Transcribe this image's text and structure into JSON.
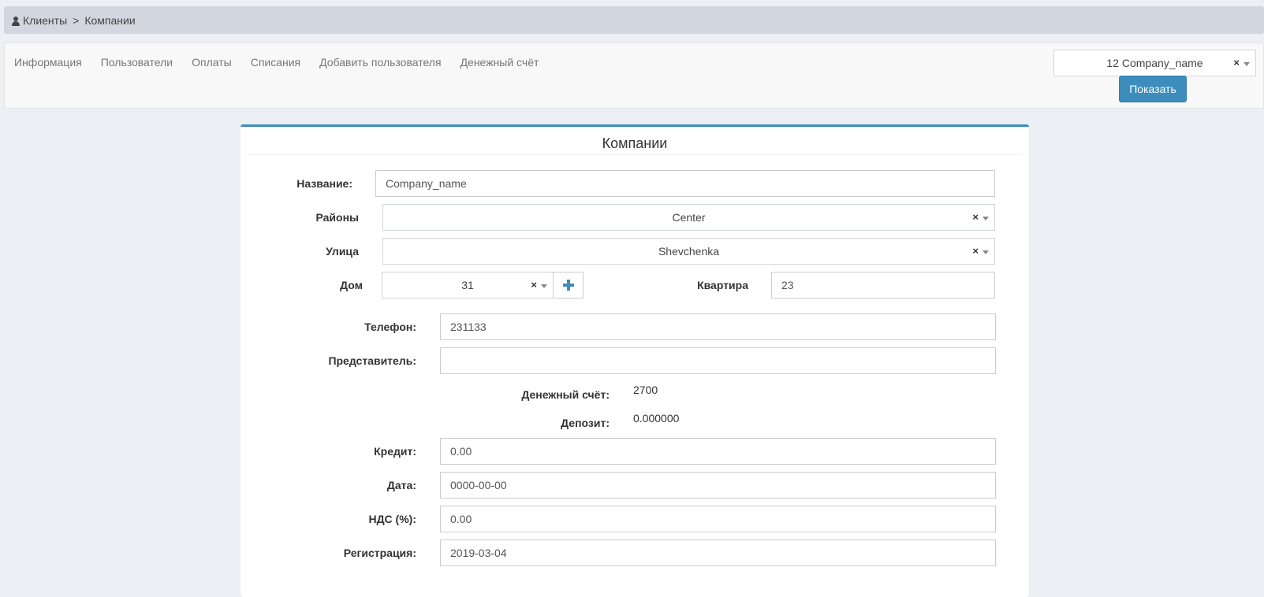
{
  "breadcrumb": {
    "root": "Клиенты",
    "separator": ">",
    "current": "Компании",
    "icon": "user-icon"
  },
  "nav": {
    "links": [
      "Информация",
      "Пользователи",
      "Оплаты",
      "Списания",
      "Добавить пользователя",
      "Денежный счёт"
    ],
    "company_select": "12 Company_name",
    "clear_symbol": "×",
    "show_button": "Показать"
  },
  "form": {
    "title": "Компании",
    "name_label": "Название:",
    "name_value": "Company_name",
    "district_label": "Районы",
    "district_value": "Center",
    "street_label": "Улица",
    "street_value": "Shevchenka",
    "house_label": "Дом",
    "house_value": "31",
    "apartment_label": "Квартира",
    "apartment_value": "23",
    "phone_label": "Телефон:",
    "phone_value": "231133",
    "representative_label": "Представитель:",
    "representative_value": "",
    "account_label": "Денежный счёт:",
    "account_value": "2700",
    "deposit_label": "Депозит:",
    "deposit_value": "0.000000",
    "credit_label": "Кредит:",
    "credit_value": "0.00",
    "date_label": "Дата:",
    "date_value": "0000-00-00",
    "vat_label": "НДС (%):",
    "vat_value": "0.00",
    "registration_label": "Регистрация:",
    "registration_value": "2019-03-04"
  },
  "colors": {
    "accent": "#3c8dbc",
    "background": "#ecf0f5",
    "breadcrumb_bg": "#d2d6de"
  }
}
